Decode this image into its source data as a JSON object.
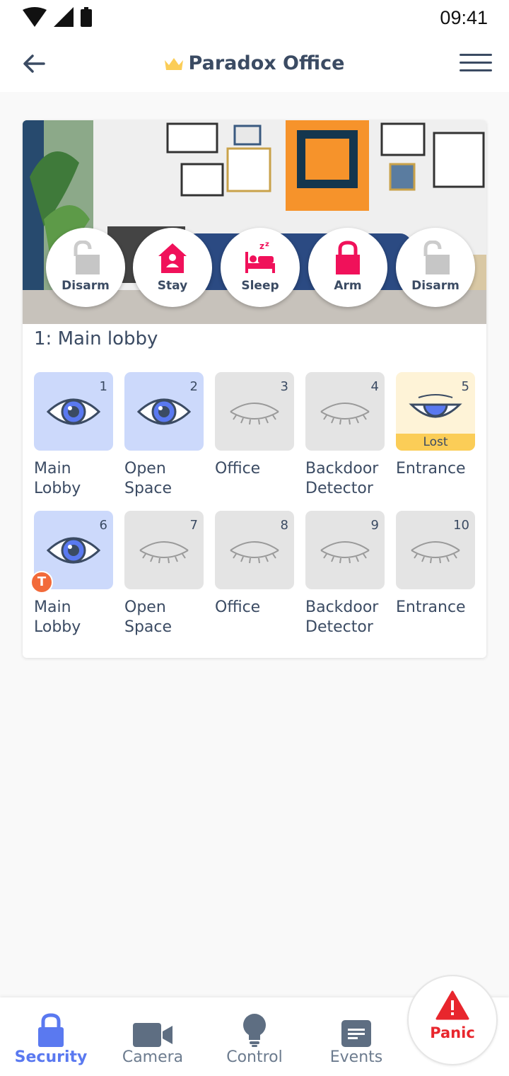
{
  "status_bar": {
    "time": "09:41"
  },
  "header": {
    "title": "Paradox Office"
  },
  "area": {
    "title": "1: Main lobby"
  },
  "modes": [
    {
      "label": "Disarm",
      "icon": "unlock-icon"
    },
    {
      "label": "Stay",
      "icon": "home-icon"
    },
    {
      "label": "Sleep",
      "icon": "sleep-icon"
    },
    {
      "label": "Arm",
      "icon": "lock-icon"
    },
    {
      "label": "Disarm",
      "icon": "unlock-icon"
    }
  ],
  "zones": [
    {
      "num": "1",
      "name": "Main\nLobby",
      "state": "open"
    },
    {
      "num": "2",
      "name": "Open\nSpace",
      "state": "open"
    },
    {
      "num": "3",
      "name": "Office",
      "state": "closed"
    },
    {
      "num": "4",
      "name": "Backdoor\nDetector",
      "state": "closed"
    },
    {
      "num": "5",
      "name": "Entrance",
      "state": "lost",
      "badge": "Lost"
    },
    {
      "num": "6",
      "name": "Main\nLobby",
      "state": "open",
      "trouble": "T"
    },
    {
      "num": "7",
      "name": "Open\nSpace",
      "state": "closed"
    },
    {
      "num": "8",
      "name": "Office",
      "state": "closed"
    },
    {
      "num": "9",
      "name": "Backdoor\nDetector",
      "state": "closed"
    },
    {
      "num": "10",
      "name": "Entrance",
      "state": "closed"
    }
  ],
  "nav": [
    {
      "label": "Security",
      "icon": "lock-icon",
      "selected": true
    },
    {
      "label": "Camera",
      "icon": "camera-icon"
    },
    {
      "label": "Control",
      "icon": "bulb-icon"
    },
    {
      "label": "Events",
      "icon": "events-icon"
    }
  ],
  "panic": {
    "label": "Panic",
    "icon": "warning-icon"
  },
  "colors": {
    "accent": "#5a79f0",
    "arm": "#f0115a",
    "panic": "#e8262d",
    "crown": "#fbcd57"
  }
}
